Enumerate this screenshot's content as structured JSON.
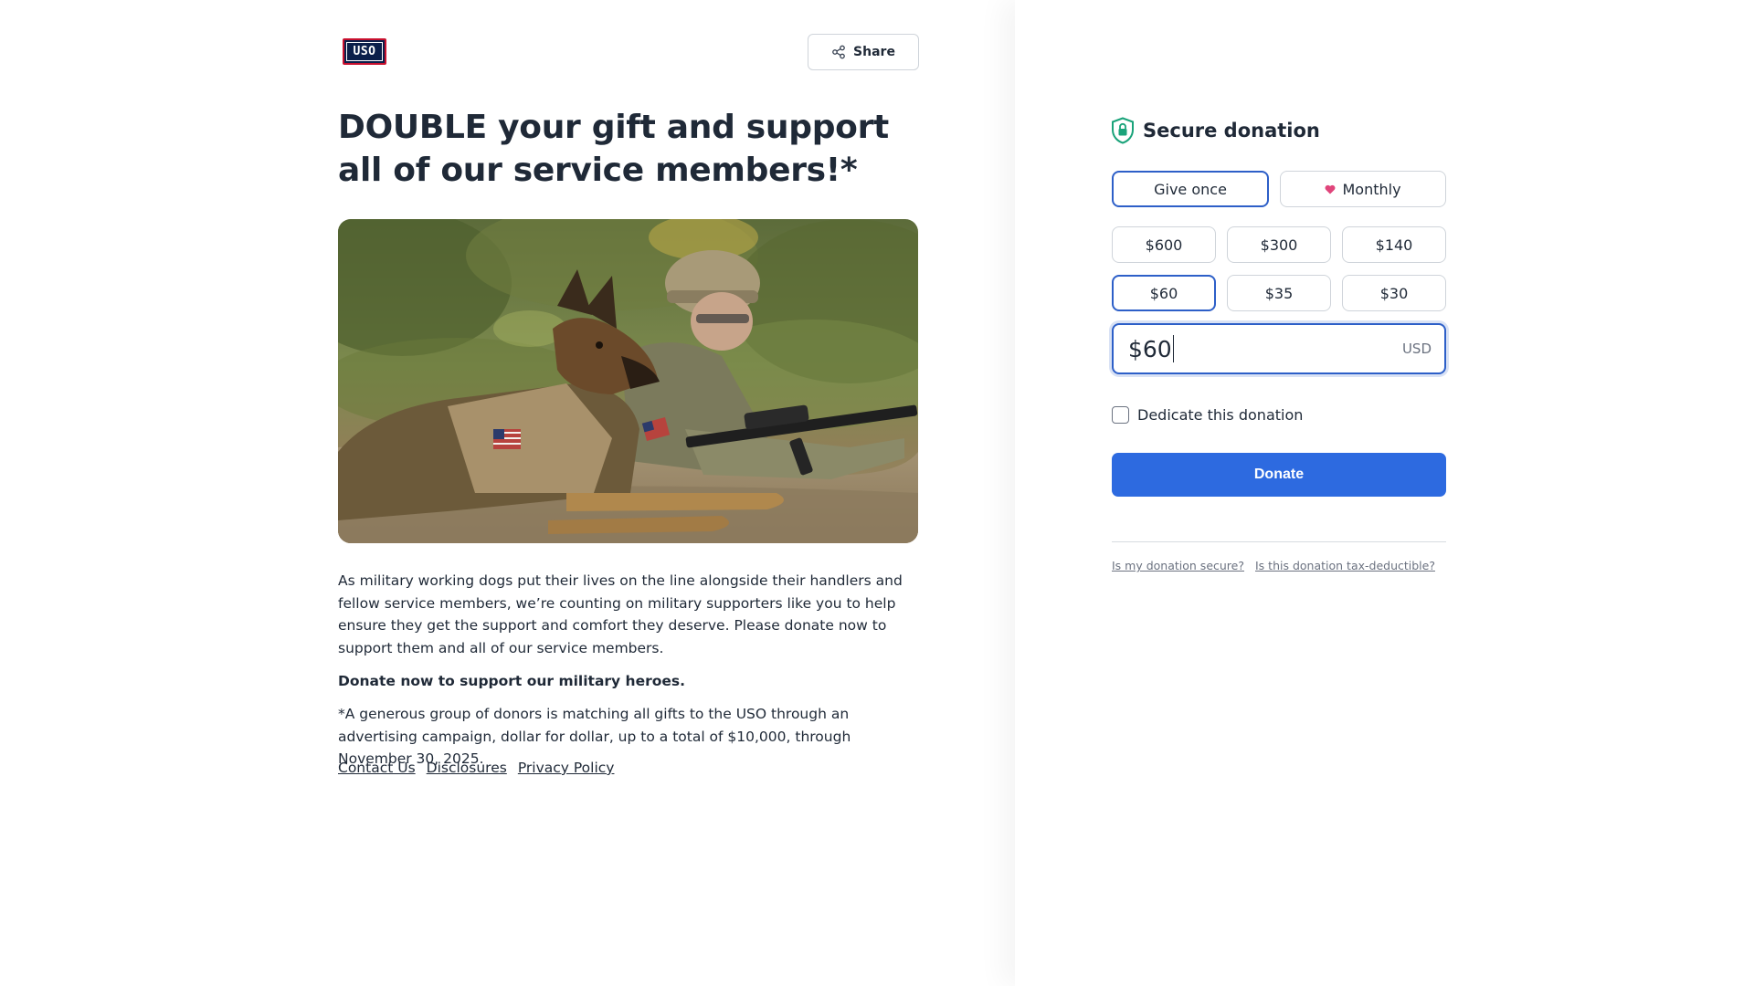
{
  "logo": {
    "text": "USO"
  },
  "header": {
    "share_label": "Share"
  },
  "headline": "DOUBLE your gift and support all of our service members!*",
  "body": {
    "paragraph1": "As military working dogs put their lives on the line alongside their handlers and fellow service members, we’re counting on military supporters like you to help ensure they get the support and comfort they deserve. Please donate now to support them and all of our service members.",
    "paragraph2": "Donate now to support our military heroes.",
    "paragraph3": "*A generous group of donors is matching all gifts to the USO through an advertising campaign, dollar for dollar, up to a total of $10,000, through November 30, 2025."
  },
  "footer_links": [
    "Contact Us",
    "Disclosures",
    "Privacy Policy"
  ],
  "donation": {
    "title": "Secure donation",
    "frequency": {
      "once": "Give once",
      "monthly": "Monthly",
      "selected": "once"
    },
    "amounts": [
      "$600",
      "$300",
      "$140",
      "$60",
      "$35",
      "$30"
    ],
    "selected_amount": "$60",
    "input_value": "$60",
    "currency": "USD",
    "dedicate_label": "Dedicate this donation",
    "dedicate_checked": false,
    "donate_label": "Donate",
    "faq": [
      "Is my donation secure?",
      "Is this donation tax-deductible?"
    ]
  },
  "colors": {
    "accent_blue": "#2d6ae0",
    "selected_border": "#2d5fc8",
    "shield_green": "#1aa37a",
    "heart_pink": "#e0457b",
    "brand_navy": "#0b1f4a",
    "brand_red": "#c8102e"
  },
  "icons": [
    "share-icon",
    "shield-lock-icon",
    "heart-icon"
  ]
}
